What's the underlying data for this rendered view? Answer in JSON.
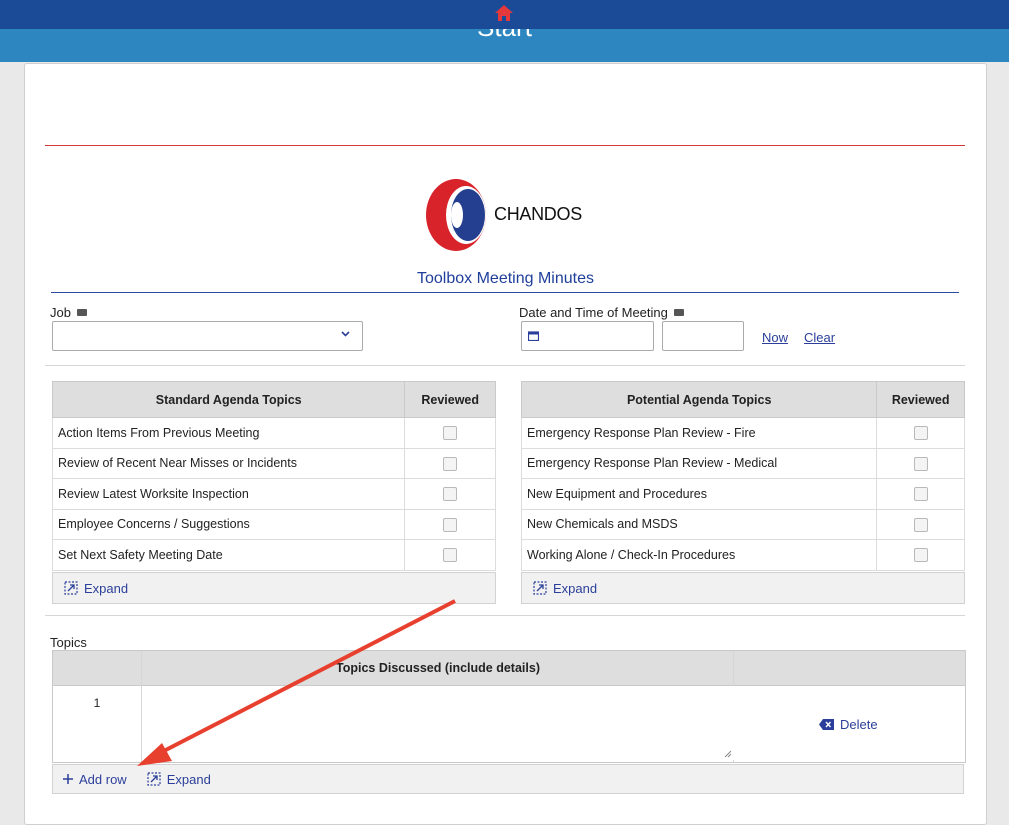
{
  "header": {
    "title": "Start"
  },
  "logo": {
    "text": "CHANDOS"
  },
  "form": {
    "title": "Toolbox Meeting Minutes"
  },
  "fields": {
    "job_label": "Job",
    "job_value": "",
    "date_label": "Date and Time of Meeting",
    "date_value": "",
    "time_value": "",
    "now_label": "Now",
    "clear_label": "Clear"
  },
  "standard_agenda": {
    "header": "Standard Agenda Topics",
    "reviewed_header": "Reviewed",
    "rows": [
      {
        "label": "Action Items From Previous Meeting",
        "checked": false
      },
      {
        "label": "Review of Recent Near Misses or Incidents",
        "checked": false
      },
      {
        "label": "Review Latest Worksite Inspection",
        "checked": false
      },
      {
        "label": "Employee Concerns / Suggestions",
        "checked": false
      },
      {
        "label": "Set Next Safety Meeting Date",
        "checked": false
      }
    ],
    "expand_label": "Expand"
  },
  "potential_agenda": {
    "header": "Potential Agenda Topics",
    "reviewed_header": "Reviewed",
    "rows": [
      {
        "label": "Emergency Response Plan Review - Fire",
        "checked": false
      },
      {
        "label": "Emergency Response Plan Review - Medical",
        "checked": false
      },
      {
        "label": "New Equipment and Procedures",
        "checked": false
      },
      {
        "label": "New Chemicals and MSDS",
        "checked": false
      },
      {
        "label": "Working Alone / Check-In Procedures",
        "checked": false
      }
    ],
    "expand_label": "Expand"
  },
  "topics": {
    "section_label": "Topics",
    "column_header": "Topics Discussed (include details)",
    "rows": [
      {
        "num": "1",
        "value": ""
      }
    ],
    "delete_label": "Delete",
    "add_row_label": "Add row",
    "expand_label": "Expand"
  },
  "colors": {
    "topbar": "#1b4b97",
    "titlebar": "#2d86c0",
    "accent": "#2b3f9a",
    "home_icon": "#e4383b",
    "annotation_arrow": "#e8402f"
  }
}
